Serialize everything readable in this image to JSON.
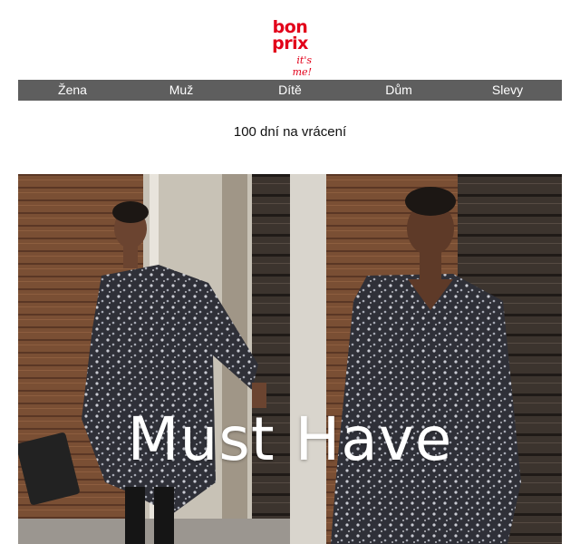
{
  "brand": {
    "logo_line1": "bon",
    "logo_line2": "prix",
    "tagline": "it's me!",
    "brand_color": "#e2001a"
  },
  "nav": {
    "items": [
      "Žena",
      "Muž",
      "Dítě",
      "Dům",
      "Slevy"
    ],
    "background": "#5e5e5e"
  },
  "promo": {
    "text": "100 dní na vrácení"
  },
  "hero": {
    "title": "Must Have"
  }
}
